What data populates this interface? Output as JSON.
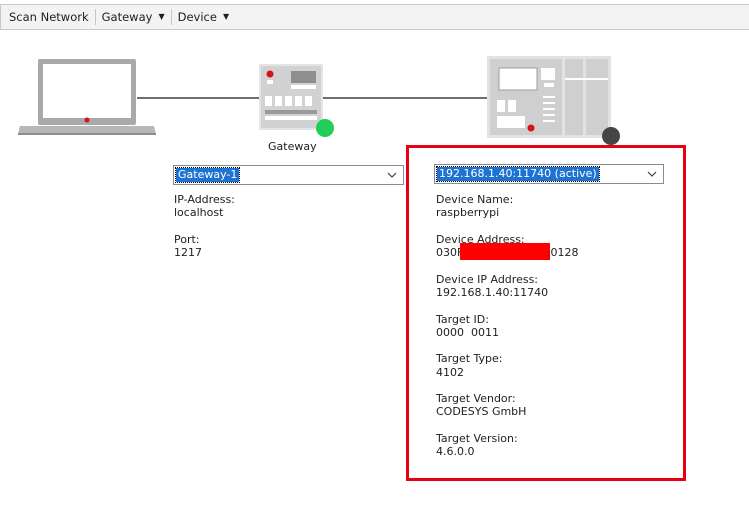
{
  "toolbar": {
    "scan_network": "Scan Network",
    "gateway_menu": "Gateway",
    "device_menu": "Device"
  },
  "gateway": {
    "name_label": "Gateway",
    "selected": "Gateway-1",
    "ip_label": "IP-Address:",
    "ip_value": "localhost",
    "port_label": "Port:",
    "port_value": "1217",
    "status_color": "#22cc55"
  },
  "device": {
    "selected": "192.168.1.40:11740 (active)",
    "status_color": "#454545",
    "fields": {
      "name_label": "Device Name:",
      "name_value": "raspberrypi",
      "address_label": "Device Address:",
      "address_prefix": "030F",
      "address_suffix": ".0128",
      "ip_label": "Device IP Address:",
      "ip_value": "192.168.1.40:11740",
      "target_id_label": "Target ID:",
      "target_id_value": "0000  0011",
      "target_type_label": "Target Type:",
      "target_type_value": "4102",
      "vendor_label": "Target Vendor:",
      "vendor_value": "CODESYS GmbH",
      "version_label": "Target Version:",
      "version_value": "4.6.0.0"
    }
  },
  "colors": {
    "highlight": "#e60012",
    "selection": "#1e73d2"
  }
}
